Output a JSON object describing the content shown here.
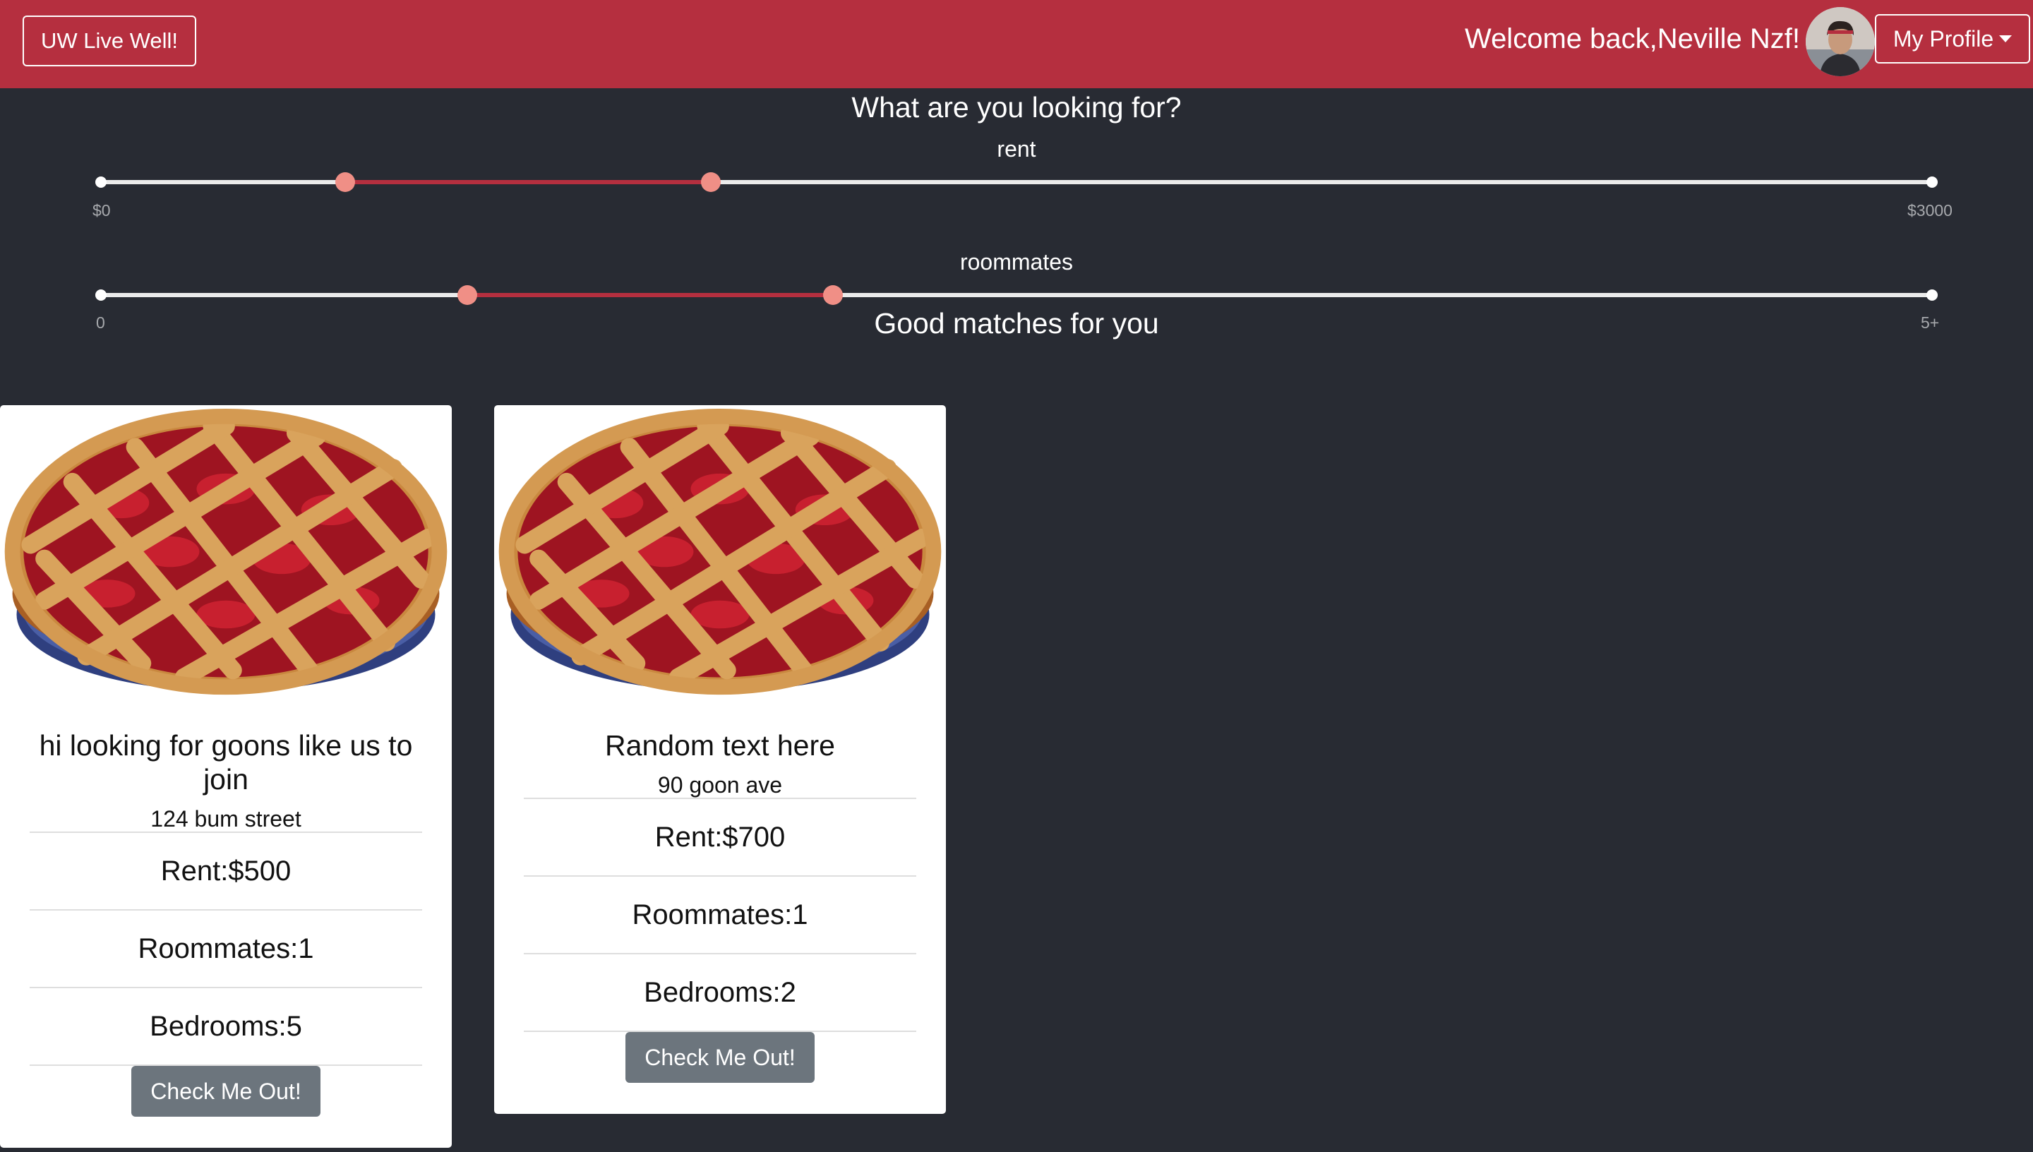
{
  "navbar": {
    "brand": "UW Live Well!",
    "welcome": "Welcome back,Neville Nzf!",
    "profile_menu": "My Profile",
    "avatar_icon": "user-avatar-photo"
  },
  "search": {
    "heading": "What are you looking for?",
    "rent": {
      "label": "rent",
      "min_label": "$0",
      "max_label": "$3000",
      "range": [
        400,
        1000
      ]
    },
    "roommates": {
      "label": "roommates",
      "min_label": "0",
      "max_label": "5+",
      "range": [
        1,
        2
      ]
    }
  },
  "matches": {
    "heading": "Good matches for you",
    "cards": [
      {
        "image_icon": "cherry-pie-image",
        "title": "hi looking for goons like us to join",
        "address": "124 bum street",
        "rent": "Rent:$500",
        "roommates": "Roommates:1",
        "bedrooms": "Bedrooms:5",
        "button": "Check Me Out!"
      },
      {
        "image_icon": "cherry-pie-image",
        "title": "Random text here",
        "address": "90 goon ave",
        "rent": "Rent:$700",
        "roommates": "Roommates:1",
        "bedrooms": "Bedrooms:2",
        "button": "Check Me Out!"
      }
    ]
  },
  "colors": {
    "navbar": "#b52f3f",
    "background": "#282b33",
    "slider_range": "#b52f3f",
    "slider_handle": "#f08f86",
    "button": "#6c757d"
  }
}
